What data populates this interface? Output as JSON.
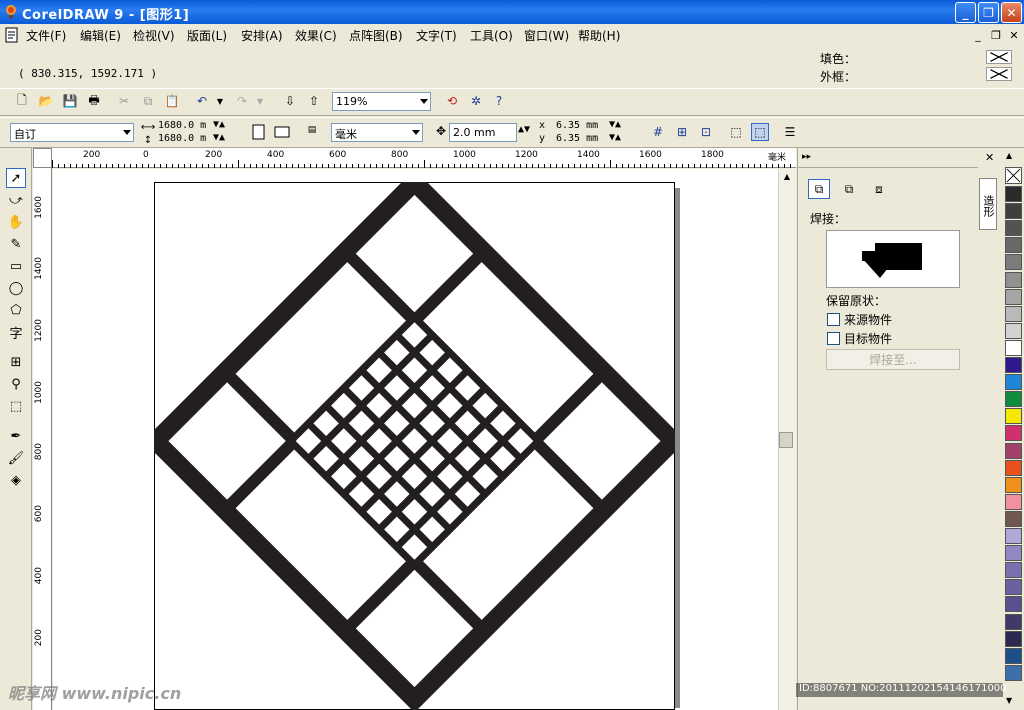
{
  "window": {
    "title": "CorelDRAW 9 - [图形1]"
  },
  "menu": [
    {
      "label": "文件(F)"
    },
    {
      "label": "编辑(E)"
    },
    {
      "label": "检视(V)"
    },
    {
      "label": "版面(L)"
    },
    {
      "label": "安排(A)"
    },
    {
      "label": "效果(C)"
    },
    {
      "label": "点阵图(B)"
    },
    {
      "label": "文字(T)"
    },
    {
      "label": "工具(O)"
    },
    {
      "label": "窗口(W)"
    },
    {
      "label": "帮助(H)"
    }
  ],
  "status": {
    "coords": "( 830.315,  1592.171 )",
    "fill_label": "填色：",
    "outline_label": "外框："
  },
  "toolbar": {
    "zoom": "119%"
  },
  "property_bar": {
    "paper": "自订",
    "width": "1680.0 m",
    "height": "1680.0 m",
    "units": "毫米",
    "nudge": "2.0 mm",
    "dup_x": "6.35 mm",
    "dup_y": "6.35 mm"
  },
  "ruler": {
    "h_ticks": [
      "200",
      "0",
      "200",
      "400",
      "600",
      "800",
      "1000",
      "1200",
      "1400",
      "1600",
      "1800"
    ],
    "h_unit": "毫米",
    "v_ticks": [
      "1600",
      "1400",
      "1200",
      "1000",
      "800",
      "600",
      "400",
      "200"
    ]
  },
  "docker": {
    "section_label": "焊接：",
    "keep_label": "保留原状：",
    "opt_source": "来源物件",
    "opt_target": "目标物件",
    "apply_button": "焊接至...",
    "tab_label": "造形"
  },
  "palette": [
    "#2b2b2b",
    "#3f3f3f",
    "#535353",
    "#686868",
    "#7c7c7c",
    "#919191",
    "#a5a5a5",
    "#bababa",
    "#d2d2d2",
    "#ffffff",
    "#2e1a8c",
    "#1f86d8",
    "#0f8c3c",
    "#f5e800",
    "#d0306c",
    "#a3406c",
    "#e8501c",
    "#f0901c",
    "#f090a0",
    "#705850",
    "#b0a8d8",
    "#9088c0",
    "#7870b0",
    "#6a62a0",
    "#585090",
    "#3f3a68",
    "#2d2a52",
    "#1c4f8c",
    "#3d6fa8"
  ],
  "watermark": {
    "id_text": "ID:8807671 NO:20111202154146171000",
    "site": "昵享网 www.nipic.cn"
  }
}
